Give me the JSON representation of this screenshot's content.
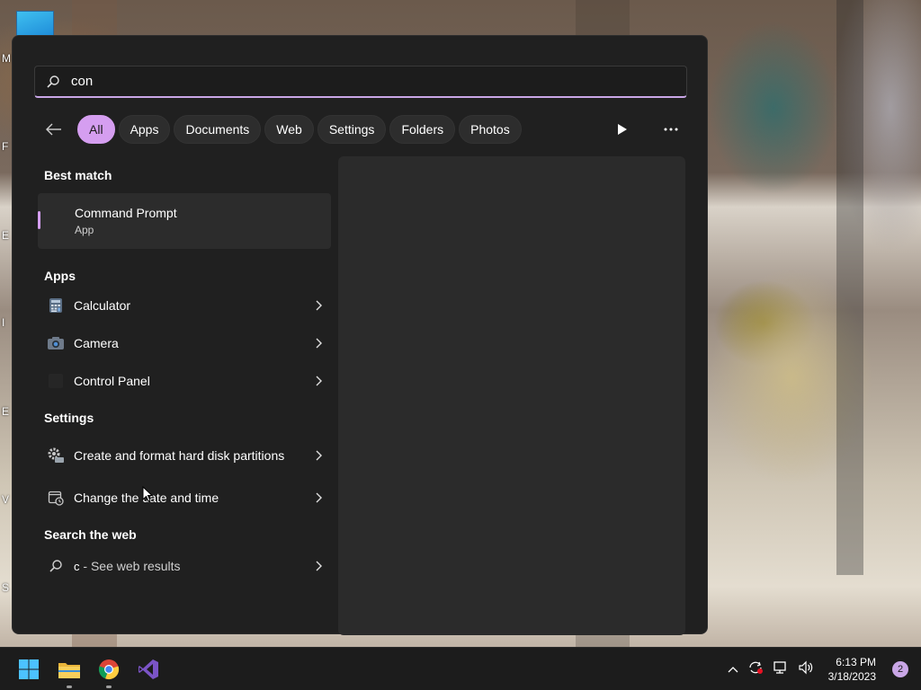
{
  "search": {
    "value": "con",
    "placeholder": ""
  },
  "filters": [
    {
      "label": "All",
      "active": true
    },
    {
      "label": "Apps"
    },
    {
      "label": "Documents"
    },
    {
      "label": "Web"
    },
    {
      "label": "Settings"
    },
    {
      "label": "Folders"
    },
    {
      "label": "Photos"
    }
  ],
  "best_match": {
    "heading": "Best match",
    "title": "Command Prompt",
    "subtitle": "App"
  },
  "apps": {
    "heading": "Apps",
    "items": [
      "Calculator",
      "Camera",
      "Control Panel"
    ]
  },
  "settings": {
    "heading": "Settings",
    "items": [
      "Create and format hard disk partitions",
      "Change the date and time"
    ]
  },
  "web": {
    "heading": "Search the web",
    "query": "c",
    "suffix": " - See web results"
  },
  "taskbar": {
    "time": "6:13 PM",
    "date": "3/18/2023",
    "notification_count": "2"
  },
  "desktop_letters": [
    "M",
    "F",
    "E",
    "I",
    "E",
    "V",
    "S"
  ],
  "colors": {
    "accent": "#d59ef0",
    "panel": "#202020",
    "preview": "#2b2b2b"
  }
}
